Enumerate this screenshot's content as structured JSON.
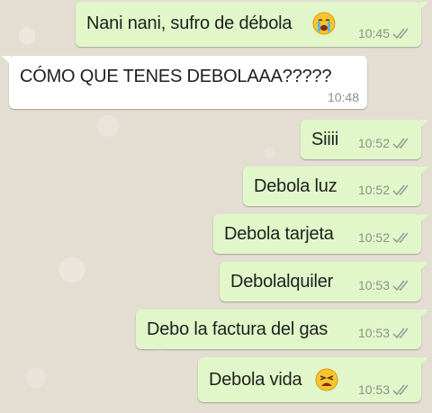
{
  "chat": {
    "messages": [
      {
        "text": "Nani nani, sufro de débola",
        "time": "10:45",
        "emoji": "loudly-crying-face",
        "direction": "outgoing"
      },
      {
        "text": "CÓMO QUE TENES DEBOLAAA?????",
        "time": "10:48",
        "direction": "incoming"
      },
      {
        "text": "Siiii",
        "time": "10:52",
        "direction": "outgoing"
      },
      {
        "text": "Debola luz",
        "time": "10:52",
        "direction": "outgoing"
      },
      {
        "text": "Debola tarjeta",
        "time": "10:52",
        "direction": "outgoing"
      },
      {
        "text": "Debolalquiler",
        "time": "10:53",
        "direction": "outgoing"
      },
      {
        "text": "Debo la factura del gas",
        "time": "10:53",
        "direction": "outgoing"
      },
      {
        "text": "Debola vida",
        "time": "10:53",
        "emoji": "weary-face",
        "direction": "outgoing"
      }
    ]
  },
  "colors": {
    "outgoing_bubble": "#e1f7c9",
    "incoming_bubble": "#ffffff",
    "background": "#e3ddd2",
    "timestamp": "#8c9288",
    "read_ticks": "#9aa396"
  }
}
